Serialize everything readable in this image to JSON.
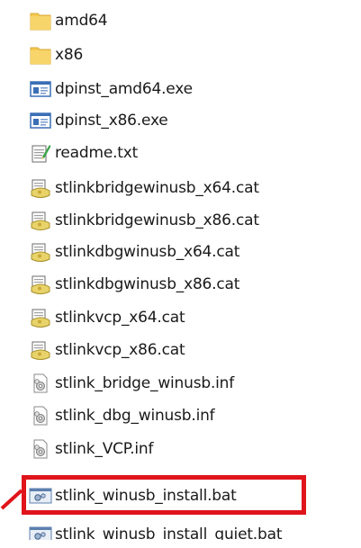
{
  "files": [
    {
      "name": "amd64",
      "type": "folder",
      "icon": "folder-icon"
    },
    {
      "name": "x86",
      "type": "folder",
      "icon": "folder-icon"
    },
    {
      "name": "dpinst_amd64.exe",
      "type": "exe",
      "icon": "application-icon"
    },
    {
      "name": "dpinst_x86.exe",
      "type": "exe",
      "icon": "application-icon"
    },
    {
      "name": "readme.txt",
      "type": "txt",
      "icon": "text-document-icon"
    },
    {
      "name": "stlinkbridgewinusb_x64.cat",
      "type": "cat",
      "icon": "security-catalog-icon"
    },
    {
      "name": "stlinkbridgewinusb_x86.cat",
      "type": "cat",
      "icon": "security-catalog-icon"
    },
    {
      "name": "stlinkdbgwinusb_x64.cat",
      "type": "cat",
      "icon": "security-catalog-icon"
    },
    {
      "name": "stlinkdbgwinusb_x86.cat",
      "type": "cat",
      "icon": "security-catalog-icon"
    },
    {
      "name": "stlinkvcp_x64.cat",
      "type": "cat",
      "icon": "security-catalog-icon"
    },
    {
      "name": "stlinkvcp_x86.cat",
      "type": "cat",
      "icon": "security-catalog-icon"
    },
    {
      "name": "stlink_bridge_winusb.inf",
      "type": "inf",
      "icon": "setup-information-icon"
    },
    {
      "name": "stlink_dbg_winusb.inf",
      "type": "inf",
      "icon": "setup-information-icon"
    },
    {
      "name": "stlink_VCP.inf",
      "type": "inf",
      "icon": "setup-information-icon"
    },
    {
      "name": "stlink_winusb_install.bat",
      "type": "bat",
      "icon": "batch-file-icon",
      "highlighted": true
    },
    {
      "name": "stlink_winusb_install_quiet.bat",
      "type": "bat",
      "icon": "batch-file-icon"
    }
  ],
  "highlight": {
    "color": "#e0141b",
    "target": "stlink_winusb_install.bat"
  },
  "colors": {
    "folder": "#f4c94f",
    "text": "#1a1a1a"
  }
}
